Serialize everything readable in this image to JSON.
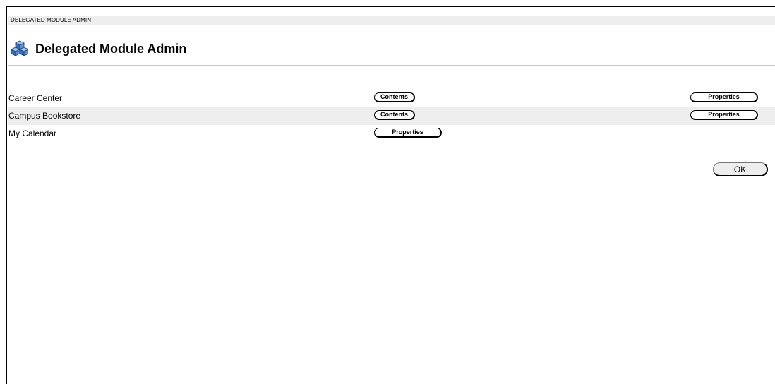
{
  "breadcrumb": "DELEGATED MODULE ADMIN",
  "page": {
    "title": "Delegated Module Admin",
    "icon": "module-cubes-icon"
  },
  "modules": [
    {
      "name": "Career Center",
      "buttons": [
        "Contents",
        "Properties"
      ]
    },
    {
      "name": "Campus Bookstore",
      "buttons": [
        "Contents",
        "Properties"
      ]
    },
    {
      "name": "My Calendar",
      "buttons": [
        "Properties"
      ]
    }
  ],
  "actions": {
    "ok_label": "OK"
  },
  "colors": {
    "row_alt_bg": "#eeeeee",
    "rule": "#c8c8c8",
    "icon_blue": "#3a6fb8"
  }
}
